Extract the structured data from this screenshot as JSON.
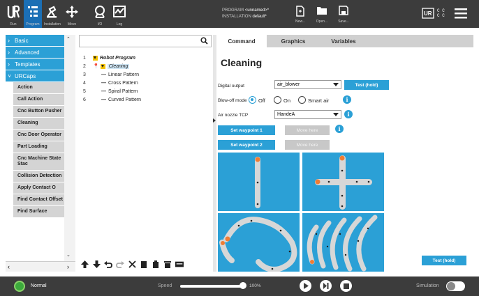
{
  "topbar": {
    "tabs": [
      {
        "label": "Run",
        "icon": "ur-logo-icon"
      },
      {
        "label": "Program",
        "icon": "program-icon"
      },
      {
        "label": "Installation",
        "icon": "installation-icon"
      },
      {
        "label": "Move",
        "icon": "move-icon"
      },
      {
        "label": "I/O",
        "icon": "io-icon"
      },
      {
        "label": "Log",
        "icon": "log-icon"
      }
    ],
    "program_label": "PROGRAM",
    "program_value": "<unnamed>*",
    "installation_label": "INSTALLATION",
    "installation_value": "default*",
    "new_label": "New...",
    "open_label": "Open...",
    "save_label": "Save...",
    "cc_text": "C C\nC C"
  },
  "leftnav": {
    "categories": [
      "Basic",
      "Advanced",
      "Templates",
      "URCaps"
    ],
    "urcaps_items": [
      "Action",
      "Call Action",
      "Cnc Button Pusher",
      "Cleaning",
      "Cnc Door Operator",
      "Part Loading",
      "Cnc Machine State Stac",
      "Collision Detection",
      "Apply Contact O",
      "Find Contact Offset",
      "Find Surface"
    ]
  },
  "tree": {
    "search_placeholder": "",
    "lines": [
      {
        "num": "1",
        "text": "Robot Program"
      },
      {
        "num": "2",
        "text": "Cleaning"
      },
      {
        "num": "3",
        "text": "Linear Pattern"
      },
      {
        "num": "4",
        "text": "Cross Pattern"
      },
      {
        "num": "5",
        "text": "Spiral Pattern"
      },
      {
        "num": "6",
        "text": "Curved Pattern"
      }
    ]
  },
  "right": {
    "tabs": [
      "Command",
      "Graphics",
      "Variables"
    ],
    "title": "Cleaning",
    "digital_output_label": "Digital output",
    "digital_output_value": "air_blower",
    "test_hold_label": "Test (hold)",
    "blowoff_label": "Blow-off mode",
    "blowoff_options": [
      "Off",
      "On",
      "Smart air"
    ],
    "blowoff_selected": "Off",
    "tcp_label": "Air nozzle TCP",
    "tcp_value": "HandeA",
    "set_wp1": "Set waypoint 1",
    "set_wp2": "Set waypoint 2",
    "move_here": "Move here",
    "test_hold_bottom": "Test (hold)"
  },
  "bottombar": {
    "status": "Normal",
    "speed_label": "Speed",
    "speed_value": "100%",
    "simulation_label": "Simulation"
  },
  "colors": {
    "accent": "#2ba0d6",
    "dark_bar": "#3c3c3c",
    "program_tab_active": "#1b6fb5",
    "status_green": "#3caa3c"
  }
}
